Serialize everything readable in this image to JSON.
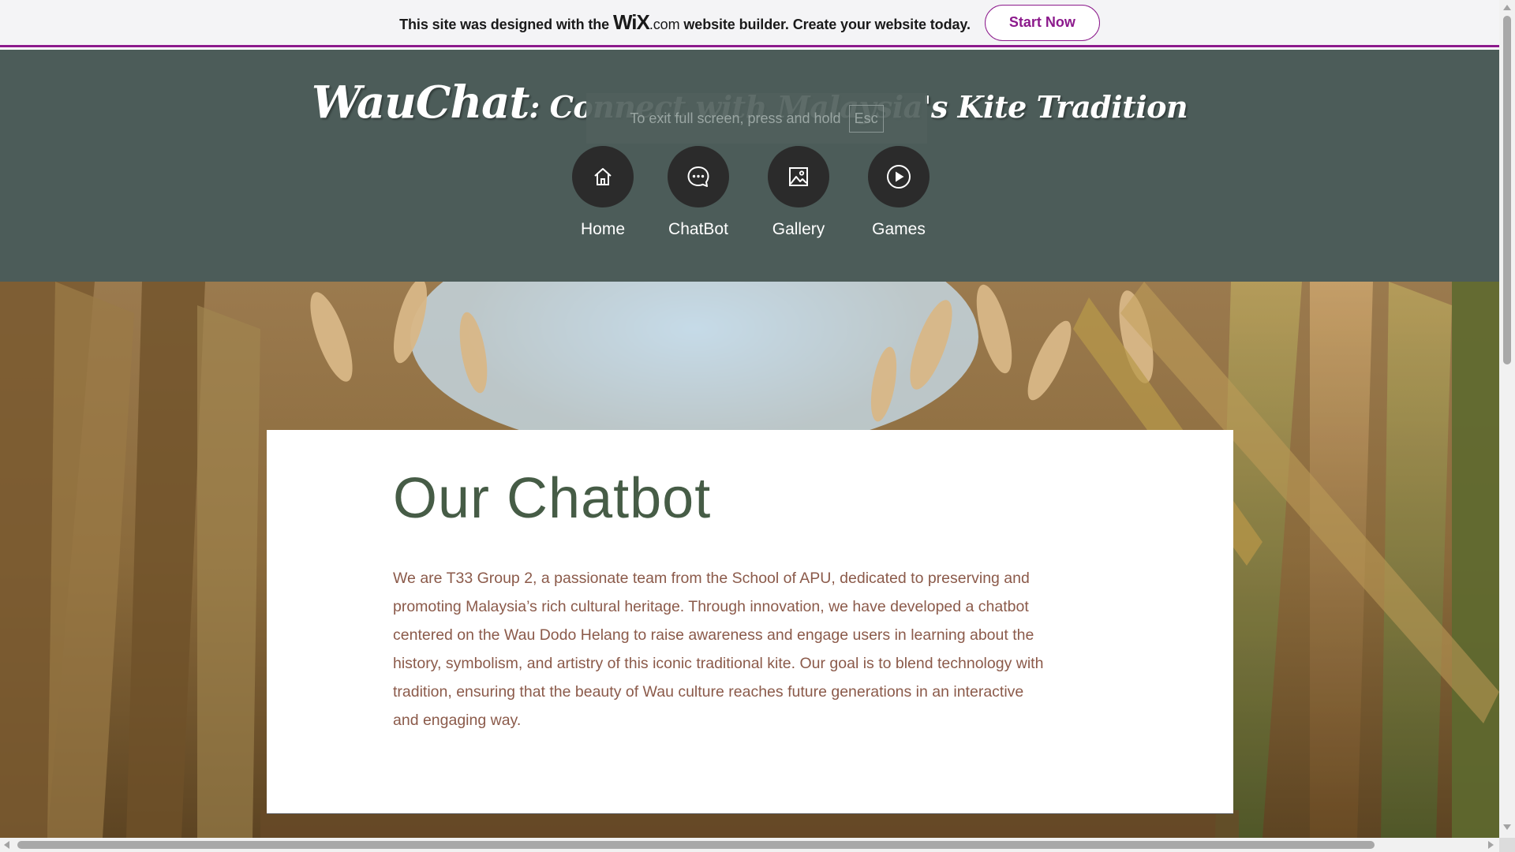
{
  "wix_banner": {
    "text_before": "This site was designed with the ",
    "logo_main": "WiX",
    "logo_domain": ".com",
    "text_after": " website builder. Create your website today.",
    "cta_label": "Start Now"
  },
  "fullscreen_notice": {
    "text": "To exit full screen, press and hold",
    "key": "Esc"
  },
  "header": {
    "brand": "WauChat",
    "separator": ": ",
    "tagline": "Connect with Malaysia's Kite Tradition",
    "nav": [
      {
        "label": "Home",
        "icon": "home-icon"
      },
      {
        "label": "ChatBot",
        "icon": "chat-bubble-icon"
      },
      {
        "label": "Gallery",
        "icon": "image-icon"
      },
      {
        "label": "Games",
        "icon": "play-icon"
      }
    ]
  },
  "section": {
    "title": "Our Chatbot",
    "body": "We are T33 Group 2, a passionate team from the School of APU, dedicated to preserving and promoting Malaysia’s rich cultural heritage. Through innovation, we have developed a chatbot centered on the Wau Dodo Helang to raise awareness and engage users in learning about the history, symbolism, and artistry of this iconic traditional kite. Our goal is to blend technology with tradition, ensuring that the beauty of Wau culture reaches future generations in an interactive and engaging way."
  },
  "colors": {
    "header_bg": "#4c5c59",
    "wix_accent": "#8c1a8c",
    "title_green": "#465c46",
    "body_brown": "#8b5a4a"
  }
}
